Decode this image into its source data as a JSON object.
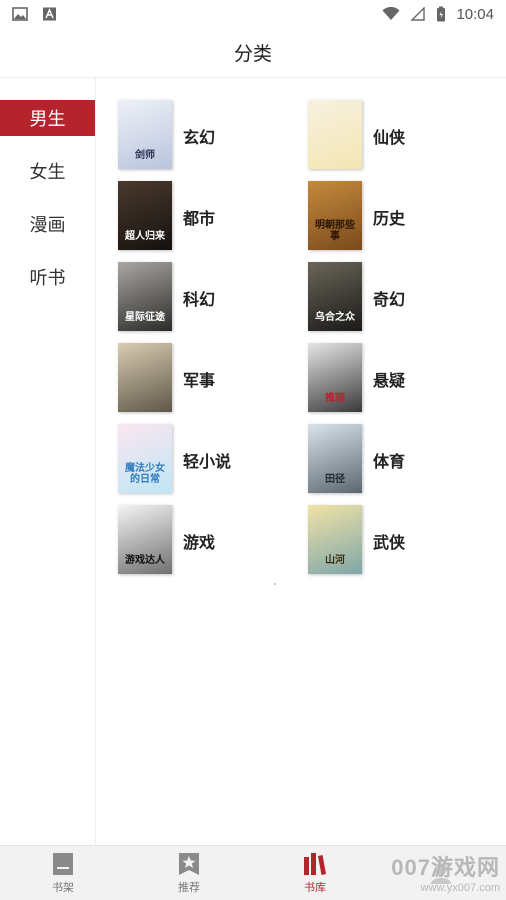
{
  "status_bar": {
    "time": "10:04",
    "left_icons": [
      "image-icon",
      "font-icon"
    ],
    "right_icons": [
      "wifi-icon",
      "signal-icon",
      "battery-icon"
    ]
  },
  "header": {
    "title": "分类"
  },
  "sidebar": {
    "items": [
      {
        "label": "男生",
        "active": true
      },
      {
        "label": "女生",
        "active": false
      },
      {
        "label": "漫画",
        "active": false
      },
      {
        "label": "听书",
        "active": false
      }
    ]
  },
  "categories": [
    {
      "label": "玄幻",
      "cover_text": "剑师",
      "cover_colors": [
        "#eef1f8",
        "#b9c4dc"
      ],
      "text_color": "#2b3550"
    },
    {
      "label": "仙侠",
      "cover_text": "",
      "cover_colors": [
        "#f7f1df",
        "#f4e6b4"
      ],
      "text_color": "#2f3f6e"
    },
    {
      "label": "都市",
      "cover_text": "超人归来",
      "cover_colors": [
        "#4a3a2e",
        "#15110e"
      ],
      "text_color": "#ffffff"
    },
    {
      "label": "历史",
      "cover_text": "明朝那些事",
      "cover_colors": [
        "#c48a3c",
        "#7a4a1c"
      ],
      "text_color": "#2a1608"
    },
    {
      "label": "科幻",
      "cover_text": "星际征途",
      "cover_colors": [
        "#a9a7a2",
        "#2d2b29"
      ],
      "text_color": "#ffffff"
    },
    {
      "label": "奇幻",
      "cover_text": "乌合之众",
      "cover_colors": [
        "#6b6659",
        "#1b1a18"
      ],
      "text_color": "#ffffff"
    },
    {
      "label": "军事",
      "cover_text": "",
      "cover_colors": [
        "#d9cdb2",
        "#5e5648"
      ],
      "text_color": "#2a2a2a"
    },
    {
      "label": "悬疑",
      "cover_text": "推理",
      "cover_colors": [
        "#e6e6e6",
        "#3a3a3a"
      ],
      "text_color": "#b5232d"
    },
    {
      "label": "轻小说",
      "cover_text": "魔法少女的日常",
      "cover_colors": [
        "#fbe6f0",
        "#bfe6f5"
      ],
      "text_color": "#2f7cc0"
    },
    {
      "label": "体育",
      "cover_text": "田径",
      "cover_colors": [
        "#dbe3ea",
        "#5b6770"
      ],
      "text_color": "#1e2a34"
    },
    {
      "label": "游戏",
      "cover_text": "游戏达人",
      "cover_colors": [
        "#f5f5f5",
        "#6f6f6f"
      ],
      "text_color": "#111111"
    },
    {
      "label": "武侠",
      "cover_text": "山河",
      "cover_colors": [
        "#f1e3a6",
        "#7fa6a9"
      ],
      "text_color": "#3a2c10"
    }
  ],
  "tabbar": {
    "tabs": [
      {
        "label": "书架",
        "icon": "bookshelf-icon",
        "active": false
      },
      {
        "label": "推荐",
        "icon": "star-badge-icon",
        "active": false
      },
      {
        "label": "书库",
        "icon": "library-icon",
        "active": true
      },
      {
        "label": "",
        "icon": "profile-icon",
        "active": false
      }
    ],
    "watermark_big": "007游戏网",
    "watermark_small": "www.yx007.com"
  },
  "colors": {
    "accent": "#b5232d",
    "divider": "#eeeeee",
    "tabbar_bg": "#f2f2f2"
  }
}
